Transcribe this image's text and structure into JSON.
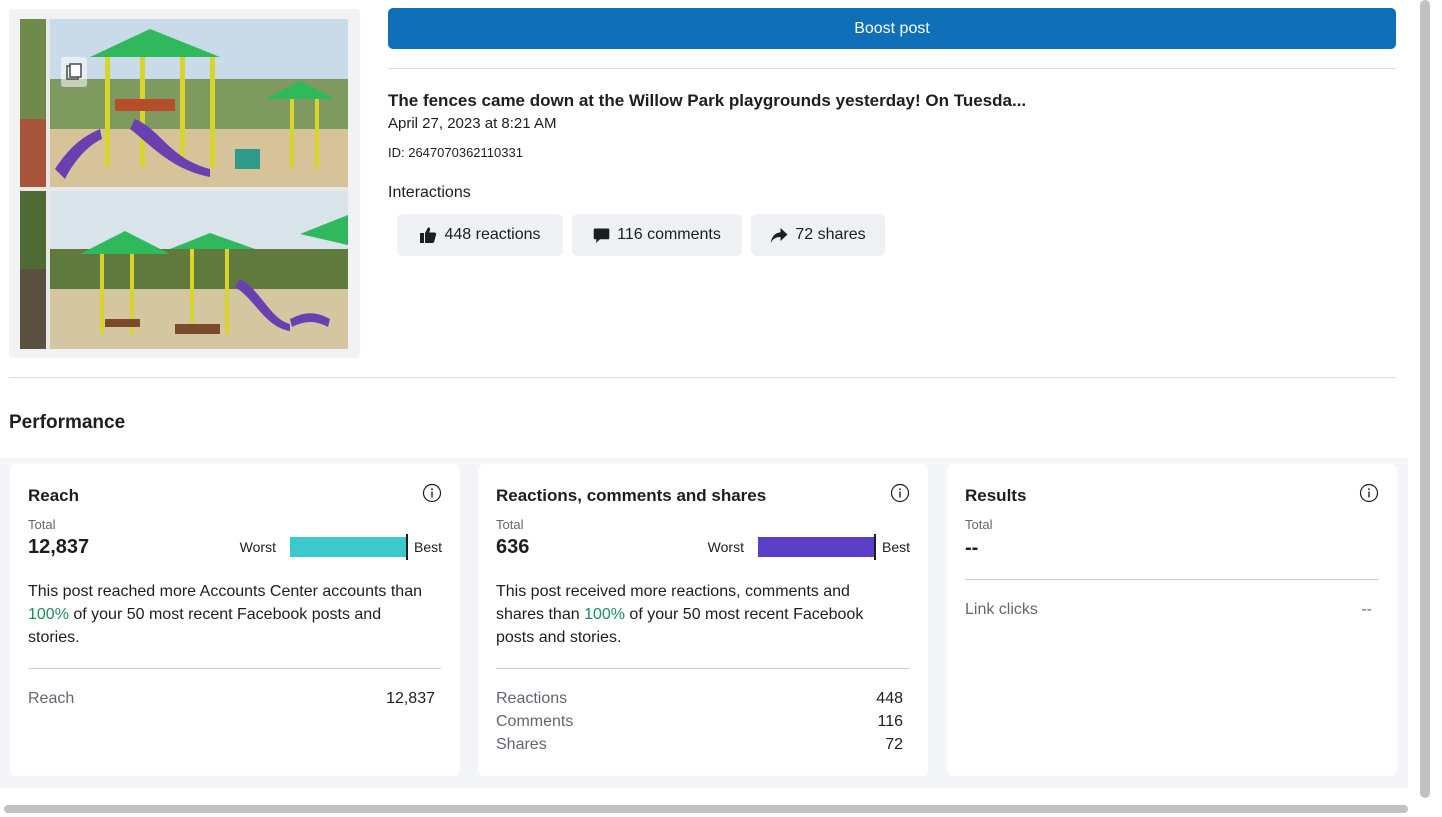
{
  "boost": {
    "label": "Boost post",
    "color": "#0f6fb9"
  },
  "post": {
    "title": "The fences came down at the Willow Park playgrounds yesterday! On Tuesda...",
    "date": "April 27, 2023 at 8:21 AM",
    "id": "ID: 2647070362110331"
  },
  "interactions": {
    "label": "Interactions",
    "reactions": {
      "label": "448 reactions",
      "icon": "thumbs-up-icon"
    },
    "comments": {
      "label": "116 comments",
      "icon": "comment-icon"
    },
    "shares": {
      "label": "72 shares",
      "icon": "share-arrow-icon"
    }
  },
  "performance": {
    "heading": "Performance",
    "reach": {
      "title": "Reach",
      "total_label": "Total",
      "total": "12,837",
      "worst": "Worst",
      "best": "Best",
      "benchmark_fraction": 1.0,
      "bar_color": "#3cc9cc",
      "desc_before": "This post reached more Accounts Center accounts than ",
      "desc_pct": "100%",
      "desc_after": " of your 50 most recent Facebook posts and stories.",
      "rows": [
        {
          "label": "Reach",
          "value": "12,837"
        }
      ]
    },
    "rcs": {
      "title": "Reactions, comments and shares",
      "total_label": "Total",
      "total": "636",
      "worst": "Worst",
      "best": "Best",
      "benchmark_fraction": 1.0,
      "bar_color": "#5b3fc6",
      "desc_before": "This post received more reactions, comments and shares than ",
      "desc_pct": "100%",
      "desc_after": " of your 50 most recent Facebook posts and stories.",
      "rows": [
        {
          "label": "Reactions",
          "value": "448"
        },
        {
          "label": "Comments",
          "value": "116"
        },
        {
          "label": "Shares",
          "value": "72"
        }
      ]
    },
    "results": {
      "title": "Results",
      "total_label": "Total",
      "total": "--",
      "rows": [
        {
          "label": "Link clicks",
          "value": "--"
        }
      ]
    },
    "highlight_color": "#1f8b5a"
  }
}
